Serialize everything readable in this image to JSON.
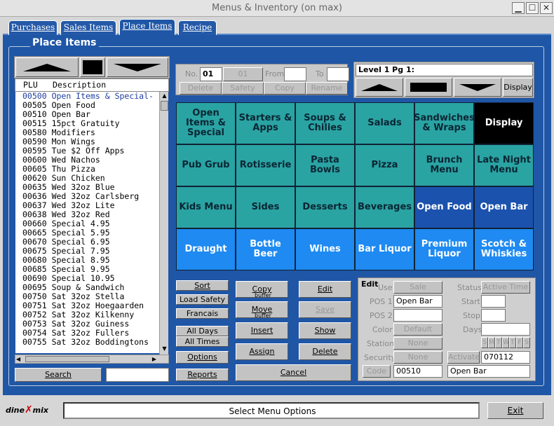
{
  "window": {
    "title": "Menus & Inventory (on max)",
    "min": "▁",
    "max": "☐",
    "close": "✕"
  },
  "tabs": [
    "Purchases",
    "Sales Items",
    "Place Items",
    "Recipe"
  ],
  "section_title": "Place Items",
  "list": {
    "headers": [
      "PLU",
      "Description"
    ],
    "items": [
      [
        "00500",
        "Open Items & Special-"
      ],
      [
        "00505",
        "Open Food"
      ],
      [
        "00510",
        "Open Bar"
      ],
      [
        "00515",
        "15pct Gratuity"
      ],
      [
        "00580",
        "Modifiers"
      ],
      [
        "00590",
        "Mon Wings"
      ],
      [
        "00595",
        "Tue $2 Off Apps"
      ],
      [
        "00600",
        "Wed Nachos"
      ],
      [
        "00605",
        "Thu Pizza"
      ],
      [
        "00620",
        "Sun Chicken"
      ],
      [
        "00635",
        "Wed 32oz Blue"
      ],
      [
        "00636",
        "Wed 32oz Carlsberg"
      ],
      [
        "00637",
        "Wed 32oz Lite"
      ],
      [
        "00638",
        "Wed 32oz Red"
      ],
      [
        "00660",
        "Special 4.95"
      ],
      [
        "00665",
        "Special 5.95"
      ],
      [
        "00670",
        "Special 6.95"
      ],
      [
        "00675",
        "Special 7.95"
      ],
      [
        "00680",
        "Special 8.95"
      ],
      [
        "00685",
        "Special 9.95"
      ],
      [
        "00690",
        "Special 10.95"
      ],
      [
        "00695",
        "Soup & Sandwich"
      ],
      [
        "00750",
        "Sat 32oz Stella"
      ],
      [
        "00751",
        "Sat 32oz Hoegaarden"
      ],
      [
        "00752",
        "Sat 32oz Kilkenny"
      ],
      [
        "00753",
        "Sat 32oz Guiness"
      ],
      [
        "00754",
        "Sat 32oz Fullers"
      ],
      [
        "00755",
        "Sat 32oz Boddingtons"
      ]
    ]
  },
  "search_label": "Search",
  "top_controls": {
    "no_label": "No.",
    "no_value": "01",
    "from_value": "01",
    "from_label": "From",
    "to_label": "To",
    "delete": "Delete",
    "safety": "Safety",
    "copy": "Copy",
    "rename": "Rename",
    "level": "Level 1 Pg 1:",
    "display": "Display"
  },
  "grid": [
    [
      "Open Items & Special",
      "Starters & Apps",
      "Soups & Chilies",
      "Salads",
      "Sandwiches & Wraps",
      "Display"
    ],
    [
      "Pub Grub",
      "Rotisserie",
      "Pasta Bowls",
      "Pizza",
      "Brunch Menu",
      "Late Night Menu"
    ],
    [
      "Kids Menu",
      "Sides",
      "Desserts",
      "Beverages",
      "Open Food",
      "Open Bar"
    ],
    [
      "Draught",
      "Bottle Beer",
      "Wines",
      "Bar Liquor",
      "Premium Liquor",
      "Scotch & Whiskies"
    ]
  ],
  "left_buttons": {
    "sort": "Sort",
    "load_safety": "Load Safety",
    "francais": "Francais",
    "all_days": "All Days",
    "all_times": "All Times",
    "options": "Options",
    "reports": "Reports"
  },
  "mid_buttons": {
    "copy": "Copy",
    "copy_sub": "buffer",
    "move": "Move",
    "move_sub": "buffer",
    "insert": "Insert",
    "assign": "Assign",
    "edit": "Edit",
    "save": "Save",
    "show": "Show",
    "delete": "Delete",
    "cancel": "Cancel"
  },
  "edit_panel": {
    "title": "Edit",
    "use": "Use",
    "sale": "Sale",
    "pos1": "POS 1",
    "pos1_value": "Open Bar",
    "pos2": "POS 2",
    "color": "Color",
    "default": "Default",
    "station": "Station",
    "none": "None",
    "security": "Security",
    "code": "Code",
    "code_value": "00510",
    "status": "Status",
    "active_time": "Active Time",
    "start": "Start",
    "stop": "Stop",
    "days": "Days",
    "daynames": "SMTWTFS",
    "activate": "Activate",
    "activate_value": "070112",
    "name_value": "Open Bar"
  },
  "status_bar": {
    "logo": "dine mix",
    "message": "Select Menu Options",
    "exit": "Exit"
  }
}
